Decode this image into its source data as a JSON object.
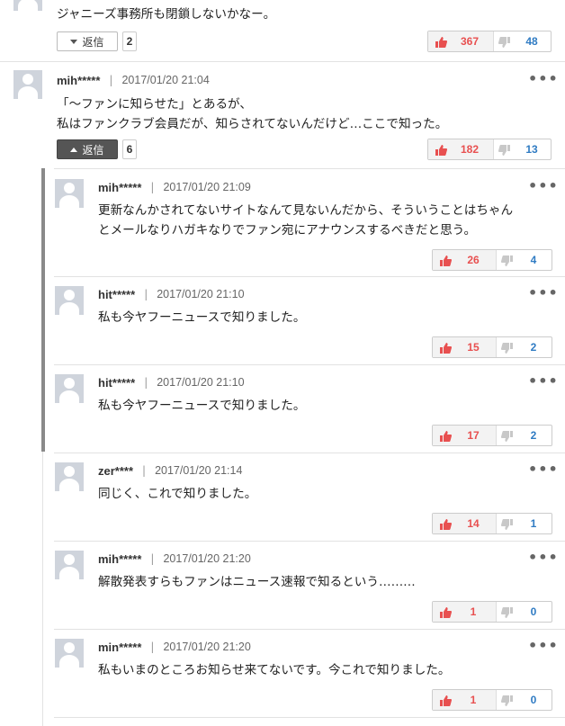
{
  "top": {
    "text": "ジャニーズ事務所も閉鎖しないかなー。",
    "reply_label": "返信",
    "reply_count": "2",
    "likes": "367",
    "dislikes": "48"
  },
  "main": {
    "user": "mih*****",
    "sep": "|",
    "date": "2017/01/20 21:04",
    "menu": "•••",
    "lines": [
      "「～ファンに知らせた」とあるが、",
      "私はファンクラブ会員だが、知らされてないんだけど…ここで知った。"
    ],
    "reply_label": "返信",
    "reply_count": "6",
    "likes": "182",
    "dislikes": "13"
  },
  "replies": [
    {
      "user": "mih*****",
      "sep": "|",
      "date": "2017/01/20 21:09",
      "menu": "•••",
      "lines": [
        "更新なんかされてないサイトなんて見ないんだから、そういうことはちゃん",
        "とメールなりハガキなりでファン宛にアナウンスするべきだと思う。"
      ],
      "likes": "26",
      "dislikes": "4"
    },
    {
      "user": "hit*****",
      "sep": "|",
      "date": "2017/01/20 21:10",
      "menu": "•••",
      "lines": [
        "私も今ヤフーニュースで知りました。"
      ],
      "likes": "15",
      "dislikes": "2"
    },
    {
      "user": "hit*****",
      "sep": "|",
      "date": "2017/01/20 21:10",
      "menu": "•••",
      "lines": [
        "私も今ヤフーニュースで知りました。"
      ],
      "likes": "17",
      "dislikes": "2"
    },
    {
      "user": "zer****",
      "sep": "|",
      "date": "2017/01/20 21:14",
      "menu": "•••",
      "lines": [
        "同じく、これで知りました。"
      ],
      "likes": "14",
      "dislikes": "1"
    },
    {
      "user": "mih*****",
      "sep": "|",
      "date": "2017/01/20 21:20",
      "menu": "•••",
      "lines": [
        "解散発表すらもファンはニュース速報で知るという………"
      ],
      "likes": "1",
      "dislikes": "0"
    },
    {
      "user": "min*****",
      "sep": "|",
      "date": "2017/01/20 21:20",
      "menu": "•••",
      "lines": [
        "私もいまのところお知らせ来てないです。今これで知りました。"
      ],
      "likes": "1",
      "dislikes": "0"
    }
  ]
}
